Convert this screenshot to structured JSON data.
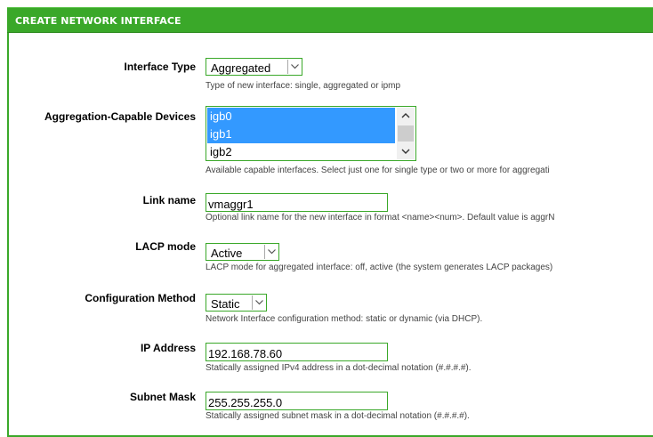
{
  "header": {
    "title": "CREATE NETWORK INTERFACE"
  },
  "fields": {
    "interface_type": {
      "label": "Interface Type",
      "value": "Aggregated",
      "help": "Type of new interface: single, aggregated or ipmp"
    },
    "aggregation_devices": {
      "label": "Aggregation-Capable Devices",
      "options": [
        {
          "label": "igb0",
          "selected": true
        },
        {
          "label": "igb1",
          "selected": true
        },
        {
          "label": "igb2",
          "selected": false
        }
      ],
      "help": "Available capable interfaces. Select just one for single type or two or more for aggregati"
    },
    "link_name": {
      "label": "Link name",
      "value": "vmaggr1",
      "help": "Optional link name for the new interface in format <name><num>. Default value is aggrN"
    },
    "lacp_mode": {
      "label": "LACP mode",
      "value": "Active",
      "help": "LACP mode for aggregated interface: off, active (the system generates LACP packages)"
    },
    "config_method": {
      "label": "Configuration Method",
      "value": "Static",
      "help": "Network Interface configuration method: static or dynamic (via DHCP)."
    },
    "ip_address": {
      "label": "IP Address",
      "value": "192.168.78.60",
      "help": "Statically assigned IPv4 address in a dot-decimal notation (#.#.#.#)."
    },
    "subnet_mask": {
      "label": "Subnet Mask",
      "value": "255.255.255.0",
      "help": "Statically assigned subnet mask in a dot-decimal notation (#.#.#.#)."
    }
  },
  "colors": {
    "accent_green": "#3aa829",
    "selection_blue": "#3399ff",
    "help_text": "#444444"
  },
  "icons": {
    "dropdown": "chevron-down-icon",
    "scroll_up": "arrow-up-icon",
    "scroll_down": "arrow-down-icon"
  }
}
